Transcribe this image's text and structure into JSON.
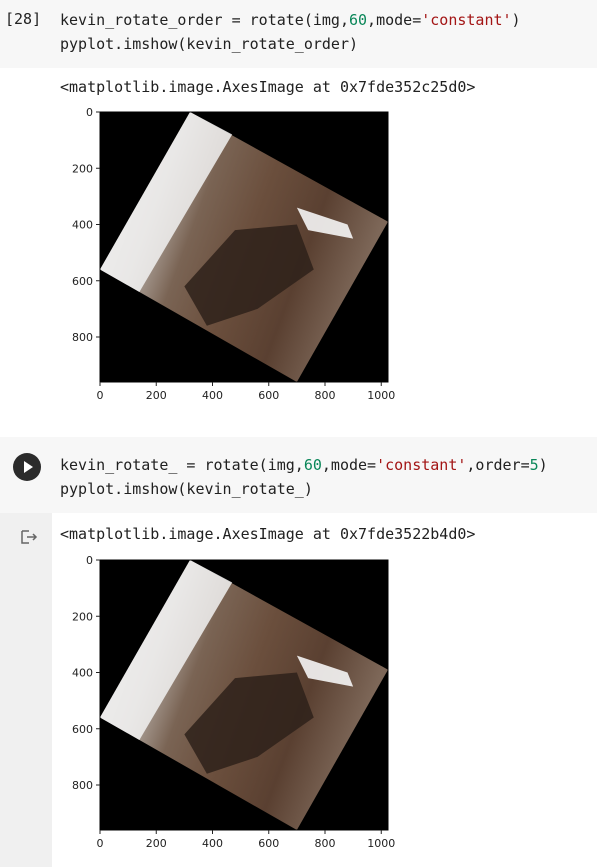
{
  "cell1": {
    "exec_count": "[28]",
    "line1": {
      "a": "kevin_rotate_order = rotate(img,",
      "n": "60",
      "b": ",mode=",
      "s": "'constant'",
      "c": ")"
    },
    "line2": "pyplot.imshow(kevin_rotate_order)",
    "output": "<matplotlib.image.AxesImage at 0x7fde352c25d0>"
  },
  "cell2": {
    "line1": {
      "a": "kevin_rotate_ = rotate(img,",
      "n": "60",
      "b": ",mode=",
      "s": "'constant'",
      "c": ",order=",
      "n2": "5",
      "d": ")"
    },
    "line2": "pyplot.imshow(kevin_rotate_)",
    "output": "<matplotlib.image.AxesImage at 0x7fde3522b4d0>"
  },
  "icons": {
    "run": "play-icon",
    "output": "output-arrow-icon"
  },
  "plot": {
    "xticks": [
      "0",
      "200",
      "400",
      "600",
      "800",
      "1000"
    ],
    "yticks": [
      "0",
      "200",
      "400",
      "600",
      "800"
    ]
  }
}
